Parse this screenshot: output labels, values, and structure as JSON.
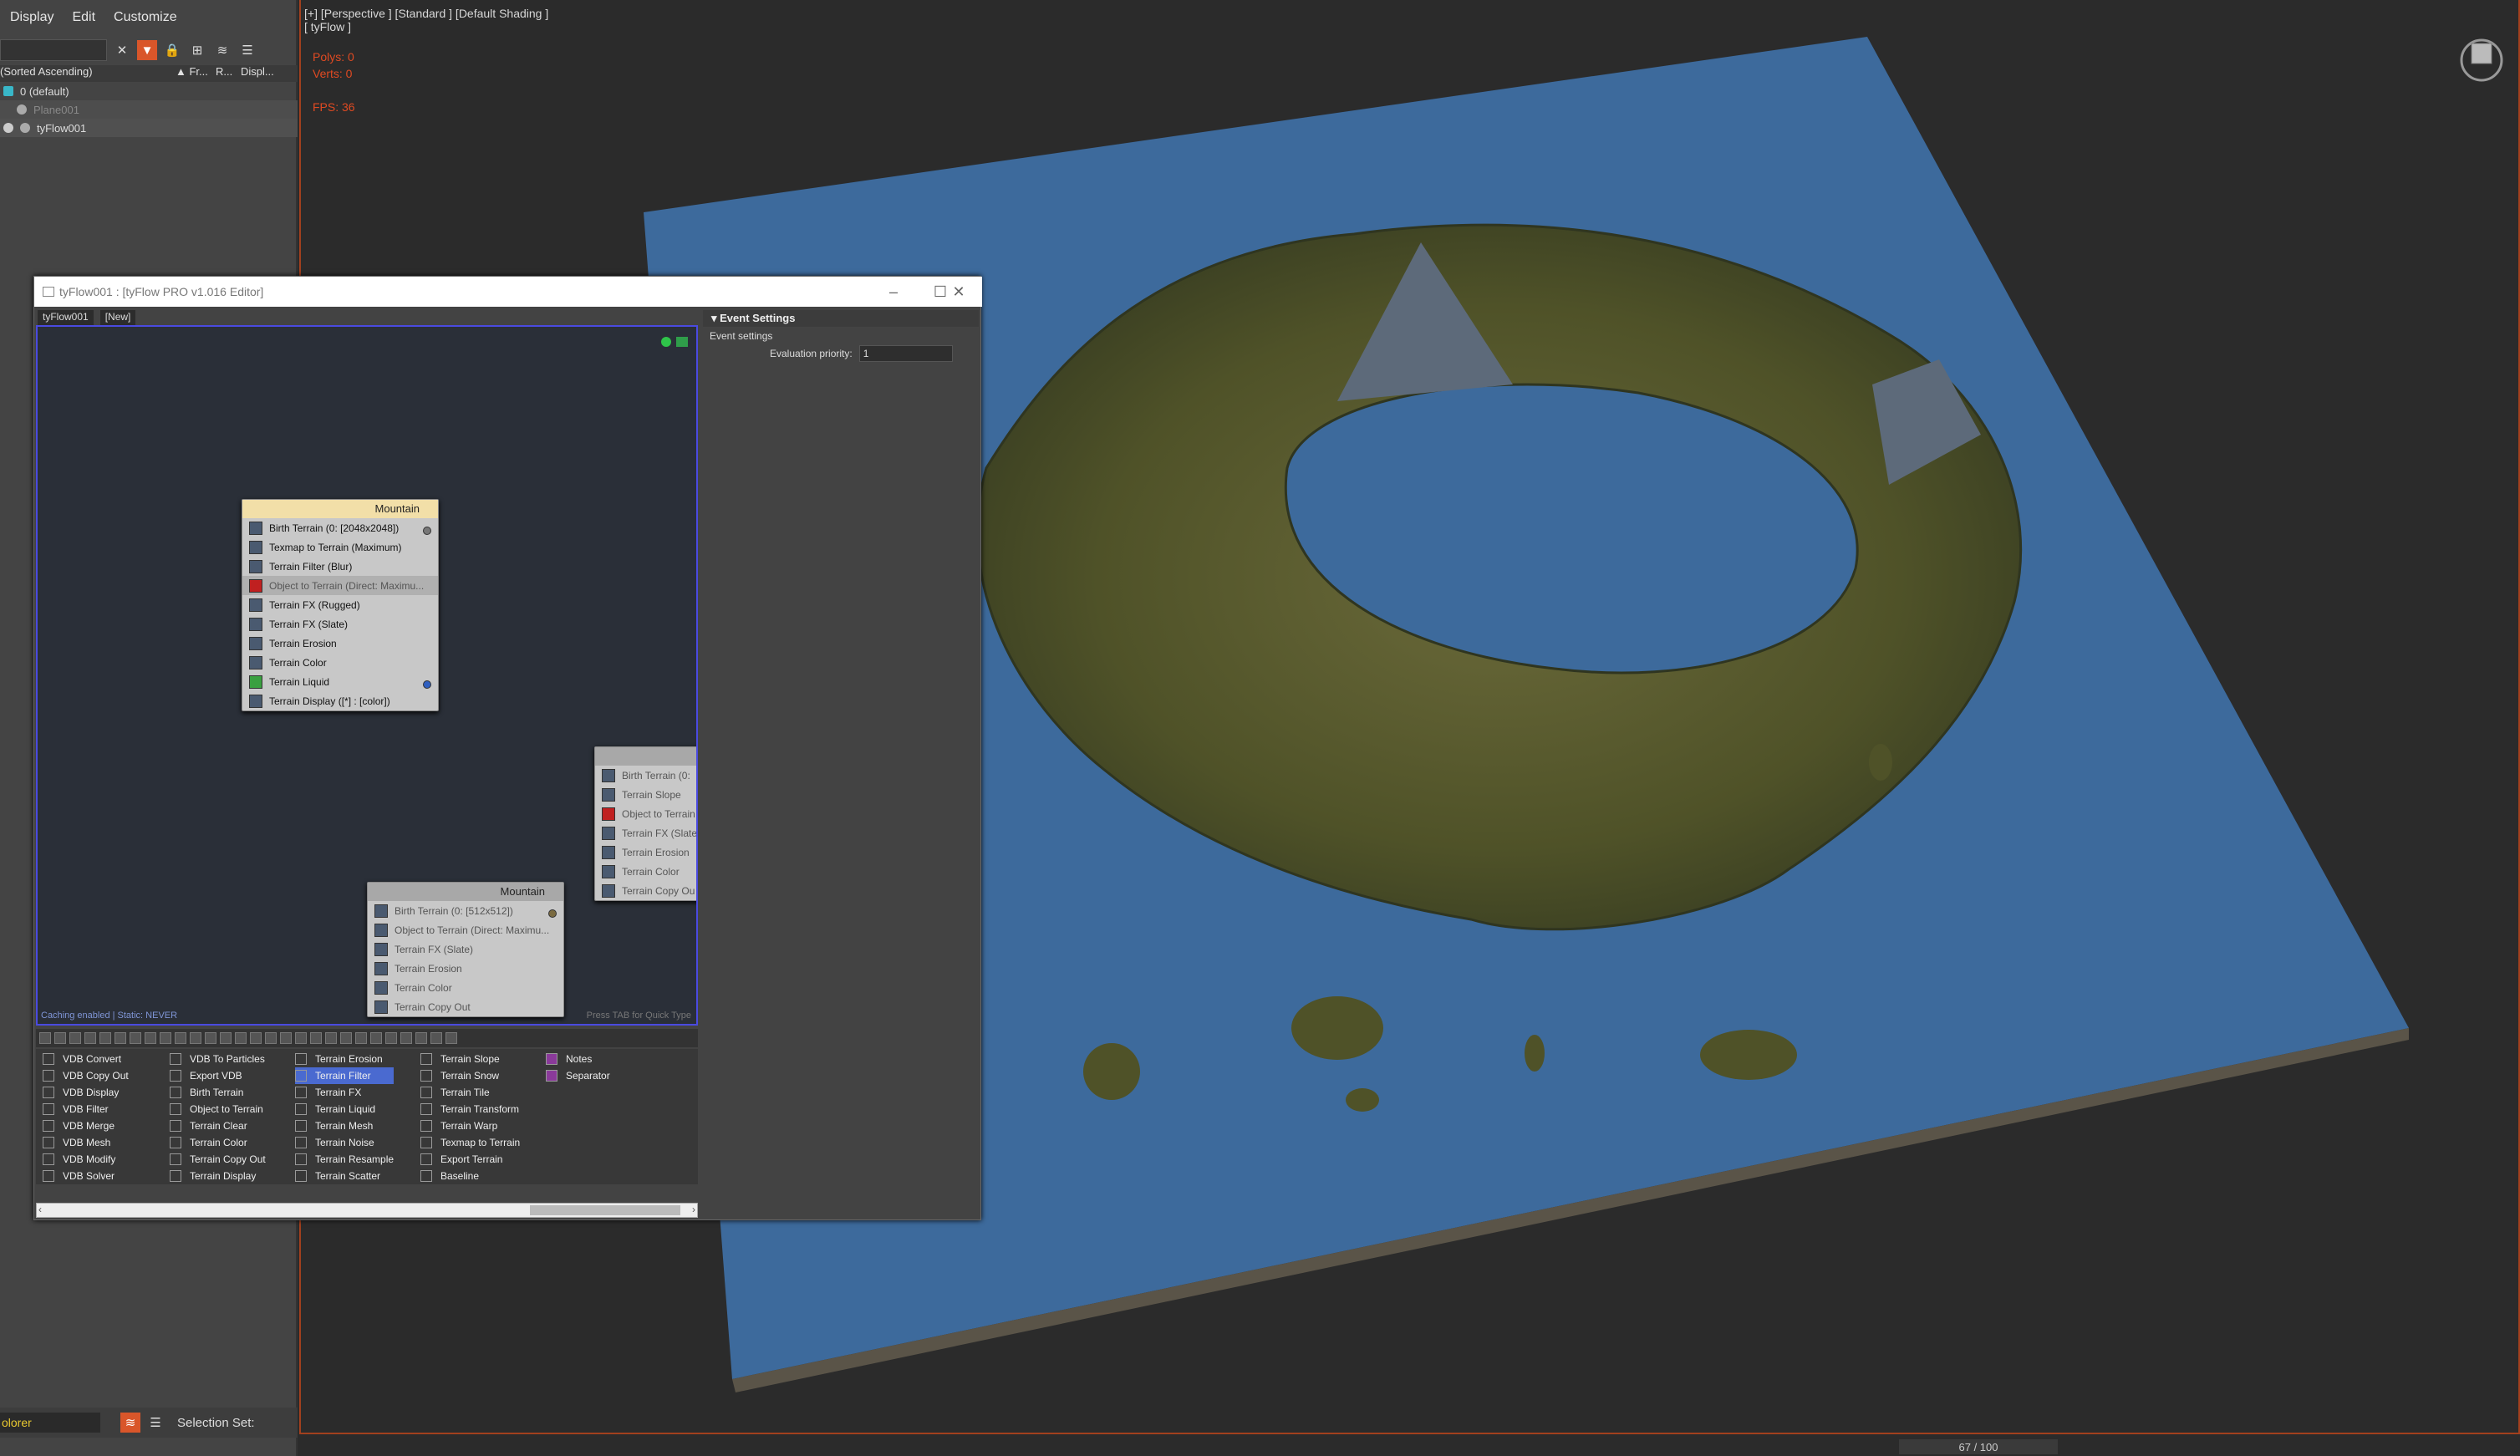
{
  "explorer": {
    "menu": [
      "Display",
      "Edit",
      "Customize"
    ],
    "sort_label": "(Sorted Ascending)",
    "columns": [
      "▲ Fr...",
      "R...",
      "Displ..."
    ],
    "rows": [
      {
        "name": "0 (default)"
      },
      {
        "name": "Plane001"
      },
      {
        "name": "tyFlow001"
      }
    ],
    "bottom": {
      "dropdown": "olorer",
      "selection_set_label": "Selection Set:"
    }
  },
  "viewport": {
    "label_line1": "[+] [Perspective ] [Standard ] [Default Shading ]",
    "label_line2": "[ tyFlow ]",
    "polys": "Polys: 0",
    "verts": "Verts: 0",
    "fps": "FPS: 36",
    "timeslider": "67 / 100"
  },
  "editor": {
    "title": "tyFlow001 : [tyFlow PRO v1.016 Editor]",
    "tabs": [
      "tyFlow001",
      "[New]"
    ],
    "caching": "Caching enabled | Static: NEVER",
    "hint": "Press TAB for Quick Type",
    "nodes": [
      {
        "title": "Mountain",
        "ops": [
          "Birth Terrain (0: [2048x2048])",
          "Texmap to Terrain (Maximum)",
          "Terrain Filter (Blur)",
          "Object to Terrain (Direct: Maximu...",
          "Terrain FX (Rugged)",
          "Terrain FX (Slate)",
          "Terrain Erosion",
          "Terrain Color",
          "Terrain Liquid",
          "Terrain Display ([*] : [color])"
        ]
      },
      {
        "title": "",
        "ops": [
          "Birth Terrain (0:",
          "Terrain Slope",
          "Object to Terrain",
          "Terrain FX (Slate",
          "Terrain Erosion",
          "Terrain Color",
          "Terrain Copy Ou"
        ]
      },
      {
        "title": "Mountain",
        "ops": [
          "Birth Terrain (0: [512x512])",
          "Object to Terrain (Direct: Maximu...",
          "Terrain FX (Slate)",
          "Terrain Erosion",
          "Terrain Color",
          "Terrain Copy Out"
        ]
      }
    ],
    "depot": [
      [
        "VDB Convert",
        "VDB Copy Out",
        "VDB Display",
        "VDB Filter",
        "VDB Merge",
        "VDB Mesh",
        "VDB Modify",
        "VDB Solver"
      ],
      [
        "VDB To Particles",
        "Export VDB",
        "Birth Terrain",
        "Object to Terrain",
        "Terrain Clear",
        "Terrain Color",
        "Terrain Copy Out",
        "Terrain Display"
      ],
      [
        "Terrain Erosion",
        "Terrain Filter",
        "Terrain FX",
        "Terrain Liquid",
        "Terrain Mesh",
        "Terrain Noise",
        "Terrain Resample",
        "Terrain Scatter"
      ],
      [
        "Terrain Slope",
        "Terrain Snow",
        "Terrain Tile",
        "Terrain Transform",
        "Terrain Warp",
        "Texmap to Terrain",
        "Export Terrain",
        "Baseline"
      ],
      [
        "Notes",
        "Separator"
      ]
    ],
    "event_settings": {
      "header": "Event Settings",
      "sub": "Event settings",
      "priority_label": "Evaluation priority:",
      "priority_value": "1"
    }
  }
}
